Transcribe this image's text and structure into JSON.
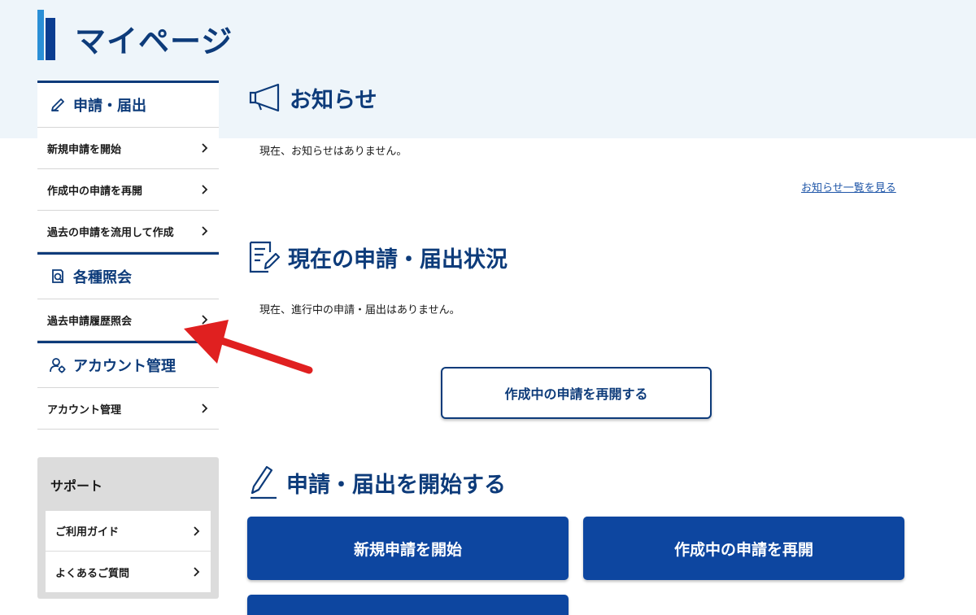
{
  "page": {
    "title": "マイページ"
  },
  "sidebar": {
    "sections": [
      {
        "heading": "申請・届出",
        "icon": "pencil-icon",
        "items": [
          "新規申請を開始",
          "作成中の申請を再開",
          "過去の申請を流用して作成"
        ]
      },
      {
        "heading": "各種照会",
        "icon": "document-search-icon",
        "items": [
          "過去申請履歴照会"
        ]
      },
      {
        "heading": "アカウント管理",
        "icon": "user-gear-icon",
        "items": [
          "アカウント管理"
        ]
      }
    ],
    "support": {
      "title": "サポート",
      "items": [
        "ご利用ガイド",
        "よくあるご質問"
      ]
    }
  },
  "main": {
    "notices": {
      "title": "お知らせ",
      "icon": "megaphone-icon",
      "text": "現在、お知らせはありません。",
      "link": "お知らせ一覧を見る"
    },
    "status": {
      "title": "現在の申請・届出状況",
      "icon": "document-edit-icon",
      "text": "現在、進行中の申請・届出はありません。",
      "resume_button": "作成中の申請を再開する"
    },
    "start": {
      "title": "申請・届出を開始する",
      "icon": "pen-icon",
      "buttons": [
        "新規申請を開始",
        "作成中の申請を再開"
      ]
    }
  },
  "colors": {
    "brand_dark": "#0d3b7a",
    "brand_button": "#0d46a0",
    "accent_light_blue": "#2a8fd6",
    "header_band": "#eef5fa",
    "annotation_arrow": "#e02020"
  }
}
